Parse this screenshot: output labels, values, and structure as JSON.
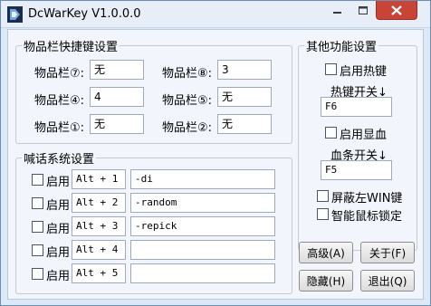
{
  "window": {
    "title": "DcWarKey V1.0.0.0",
    "icon": "app-icon",
    "controls": [
      "minimize-icon",
      "maximize-icon",
      "close-icon"
    ]
  },
  "colors": {
    "close_button": "#c74436",
    "window_bg": "#dde9f6",
    "client_bg": "#f2f5fb"
  },
  "inventory": {
    "legend": "物品栏快捷键设置",
    "slots": [
      {
        "label": "物品栏⑦:",
        "value": "无"
      },
      {
        "label": "物品栏⑧:",
        "value": "3"
      },
      {
        "label": "物品栏④:",
        "value": "4"
      },
      {
        "label": "物品栏⑤:",
        "value": "无"
      },
      {
        "label": "物品栏①:",
        "value": "无"
      },
      {
        "label": "物品栏②:",
        "value": "无"
      }
    ]
  },
  "chat": {
    "legend": "喊话系统设置",
    "rows": [
      {
        "enable_label": "启用",
        "hotkey": "Alt + 1",
        "text": "-di"
      },
      {
        "enable_label": "启用",
        "hotkey": "Alt + 2",
        "text": "-random"
      },
      {
        "enable_label": "启用",
        "hotkey": "Alt + 3",
        "text": "-repick"
      },
      {
        "enable_label": "启用",
        "hotkey": "Alt + 4",
        "text": ""
      },
      {
        "enable_label": "启用",
        "hotkey": "Alt + 5",
        "text": ""
      }
    ]
  },
  "other": {
    "legend": "其他功能设置",
    "enable_hotkey_label": "启用热键",
    "hotkey_switch_label": "热键开关↓",
    "hotkey_switch_value": "F6",
    "enable_healthbar_label": "启用显血",
    "healthbar_switch_label": "血条开关↓",
    "healthbar_switch_value": "F5",
    "block_win_label": "屏蔽左WIN键",
    "smart_lock_label": "智能鼠标锁定"
  },
  "buttons": {
    "advanced": "高级(A)",
    "about": "关于(F)",
    "hide": "隐藏(H)",
    "exit": "退出(Q)"
  }
}
